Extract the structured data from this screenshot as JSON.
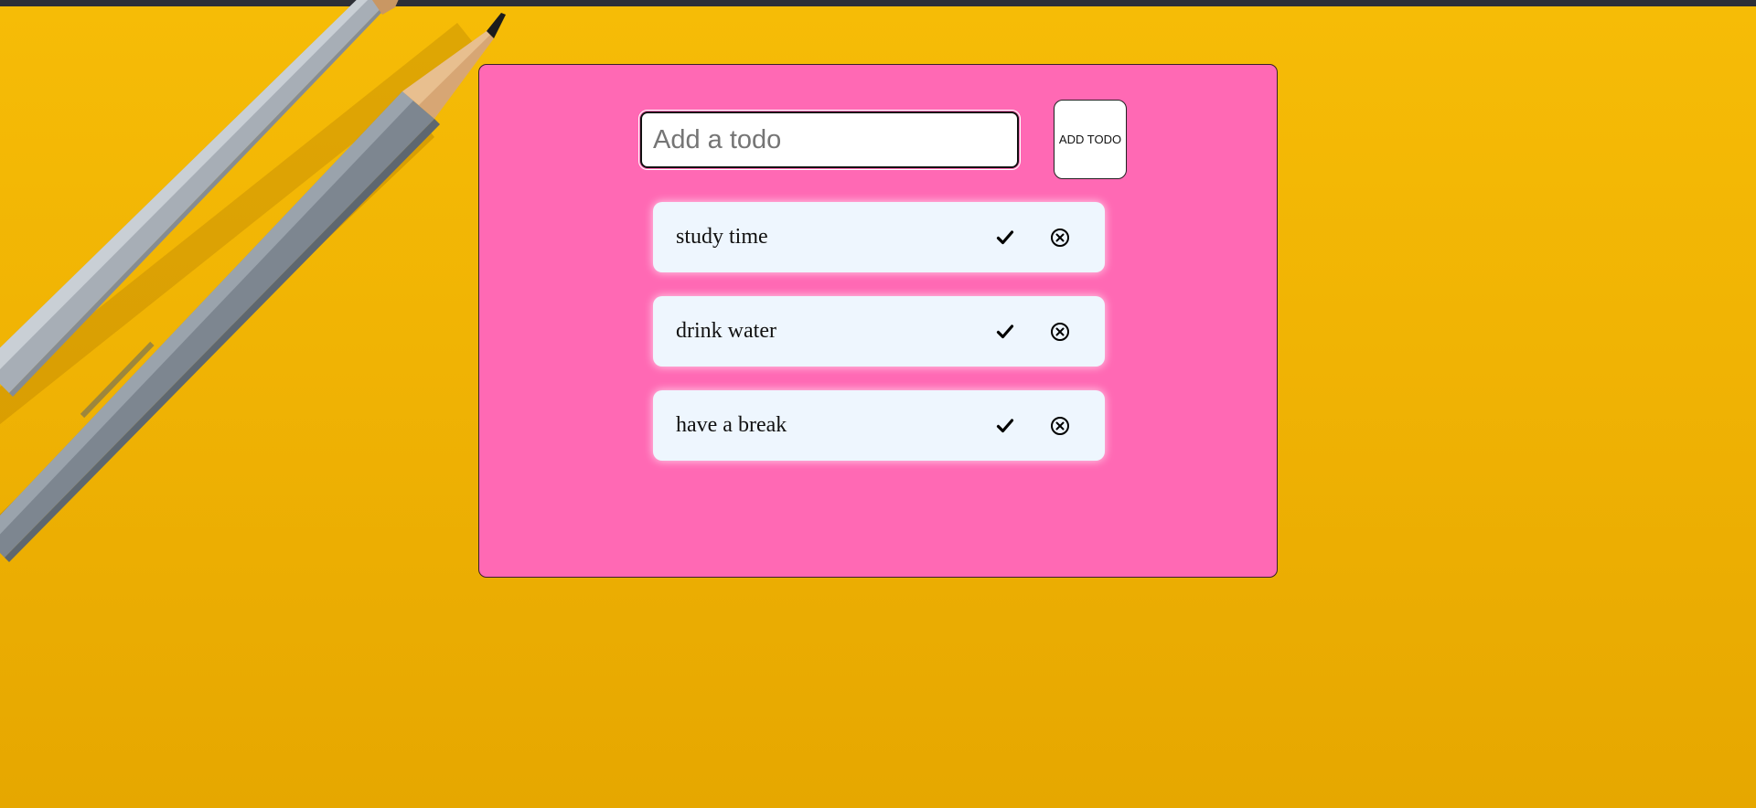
{
  "input": {
    "placeholder": "Add a todo",
    "value": ""
  },
  "add_button": {
    "label": "ADD TODO"
  },
  "todos": [
    {
      "text": "study time",
      "complete_icon": "check-icon",
      "delete_icon": "circle-x-icon"
    },
    {
      "text": "drink water",
      "complete_icon": "check-icon",
      "delete_icon": "circle-x-icon"
    },
    {
      "text": "have a break",
      "complete_icon": "check-icon",
      "delete_icon": "circle-x-icon"
    }
  ],
  "colors": {
    "background": "#f0b304",
    "card": "#ff69b4",
    "todo_item": "#eef6fe"
  }
}
